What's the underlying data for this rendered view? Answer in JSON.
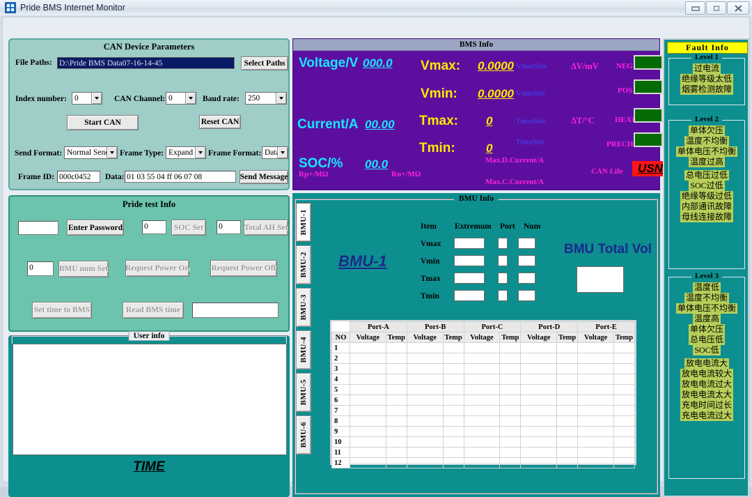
{
  "window": {
    "title": "Pride BMS Internet Monitor",
    "icon": "app-icon",
    "minimize": "–",
    "maximize": "□",
    "close": "✕"
  },
  "can_panel": {
    "title": "CAN Device Parameters",
    "file_paths_label": "File Paths:",
    "file_paths_value": "D:\\Pride BMS Data07-16-14-45",
    "select_paths_button": "Select Paths",
    "index_number_label": "Index number:",
    "index_number_value": "0",
    "can_channel_label": "CAN Channel:",
    "can_channel_value": "0",
    "baud_rate_label": "Baud rate:",
    "baud_rate_value": "250",
    "start_can_button": "Start CAN",
    "reset_can_button": "Reset CAN",
    "send_format_label": "Send Format:",
    "send_format_value": "Normal Send",
    "frame_type_label": "Frame Type:",
    "frame_type_value": "Expand",
    "frame_format_label": "Frame Format:",
    "frame_format_value": "Data",
    "frame_id_label": "Frame ID:",
    "frame_id_value": "000c0452",
    "data_label": "Data:",
    "data_value": "01 03 55 04 ff 06 07 08",
    "send_message_button": "Send Message"
  },
  "pride_panel": {
    "title": "Pride test Info",
    "password_value": "",
    "enter_password_button": "Enter Password",
    "soc_value": "0",
    "soc_set_button": "SOC Set",
    "total_ah_value": "0",
    "total_ah_set_button": "Total AH Set",
    "bmu_num_value": "0",
    "bmu_num_set_button": "BMU num Set",
    "request_power_on_button": "Request Power On",
    "request_power_off_button": "Request Power Off",
    "set_time_button": "Set time to BMS",
    "read_time_button": "Read BMS time",
    "time_value": ""
  },
  "user_panel": {
    "title": "User info",
    "time_label": "TIME",
    "content": ""
  },
  "bms_panel": {
    "title": "BMS Info",
    "voltage_label": "Voltage/V",
    "voltage_value": "000.0",
    "current_label": "Current/A",
    "current_value": "00.00",
    "soc_label": "SOC/%",
    "soc_value": "00.0",
    "vmax_label": "Vmax:",
    "vmax_value": "0.0000",
    "vmin_label": "Vmin:",
    "vmin_value": "0.0000",
    "tmax_label": "Tmax:",
    "tmax_value": "0",
    "tmin_label": "Tmin:",
    "tmin_value": "0",
    "vmax_site_label": "VmaxSite",
    "vmin_site_label": "VminSite",
    "tmax_site_label": "TmaxSite",
    "tmin_site_label": "TminSite",
    "dv_label": "ΔV/mV",
    "dt_label": "ΔT/°C",
    "neg_label": "NEG",
    "pos_label": "POS",
    "heat_label": "HEAT",
    "prechg_label": "PRECHG",
    "rp_label": "Rp+/MΩ",
    "rn_label": "Rn+/MΩ",
    "max_d_current_label": "Max.D.Current/A",
    "max_c_current_label": "Max.C.Current/A",
    "can_life_label": "CAN Life",
    "can_life_value": "USN",
    "indicator_color": "#046b04",
    "usn_color": "#ff1414"
  },
  "bmu_panel": {
    "title": "BMU Info",
    "tabs": [
      "BMU-1",
      "BMU-2",
      "BMU-3",
      "BMU-4",
      "BMU-5",
      "BMU-6"
    ],
    "active_tab": "BMU-1",
    "selected_title": "BMU-1",
    "headers": [
      "Item",
      "Extremum",
      "Port",
      "Num"
    ],
    "rows": [
      "Vmax",
      "Vmin",
      "Tmax",
      "Tmin"
    ],
    "total_vol_label": "BMU Total Vol",
    "total_vol_value": "",
    "table": {
      "ports": [
        "Port-A",
        "Port-B",
        "Port-C",
        "Port-D",
        "Port-E"
      ],
      "no_header": "NO",
      "sub_headers": [
        "Voltage",
        "Temp"
      ],
      "row_numbers": [
        "1",
        "2",
        "3",
        "4",
        "5",
        "6",
        "7",
        "8",
        "9",
        "10",
        "11",
        "12"
      ]
    }
  },
  "fault_panel": {
    "title": "Fault Info",
    "levels": [
      {
        "name": "Level 1",
        "items": [
          "过电流",
          "绝缘等级太低",
          "烟雾检测故障"
        ]
      },
      {
        "name": "Level 2",
        "items": [
          "单体欠压",
          "温度不均衡",
          "单体电压不均衡",
          "温度过高",
          "",
          "总电压过低",
          "SOC过低",
          "绝缘等级过低",
          "内部通讯故障",
          "母线连接故障"
        ]
      },
      {
        "name": "Level 3",
        "items": [
          "温度低",
          "温度不均衡",
          "单体电压不均衡",
          "温度高",
          "单体欠压",
          "总电压低",
          "SOC低",
          "",
          "放电电流大",
          "放电电流较大",
          "放电电流过大",
          "放电电流太大",
          "充电时间过长",
          "充电电流过大"
        ]
      }
    ],
    "item_bg": "#b7cf5a"
  }
}
